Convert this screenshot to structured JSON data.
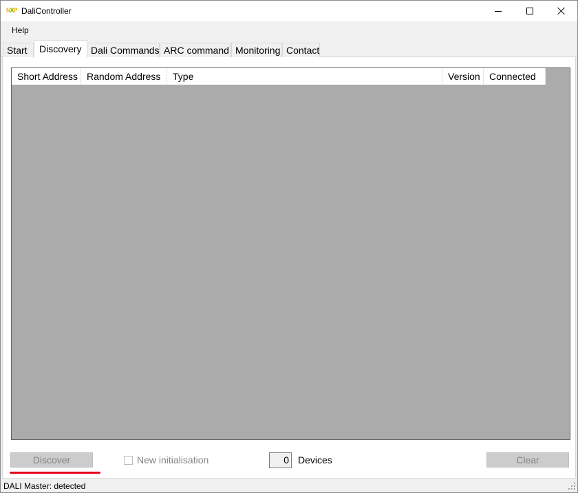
{
  "window": {
    "title": "DaliController",
    "logo": {
      "n": "N",
      "x": "X",
      "p": "P"
    }
  },
  "menu": {
    "help": "Help"
  },
  "tabs": [
    {
      "label": "Start"
    },
    {
      "label": "Discovery"
    },
    {
      "label": "Dali Commands"
    },
    {
      "label": "ARC command"
    },
    {
      "label": "Monitoring"
    },
    {
      "label": "Contact"
    }
  ],
  "active_tab": "Discovery",
  "table": {
    "columns": [
      "Short Address",
      "Random Address",
      "Type",
      "Version",
      "Connected"
    ],
    "rows": []
  },
  "controls": {
    "discover_label": "Discover",
    "new_init_label": "New initialisation",
    "new_init_checked": false,
    "device_count": "0",
    "devices_label": "Devices",
    "clear_label": "Clear"
  },
  "status": {
    "text": "DALI Master: detected"
  },
  "colors": {
    "accent_underline": "#e3001b",
    "list_background": "#ababab",
    "window_background": "#f0f0f0"
  },
  "icons": [
    "nxp-logo-icon",
    "minimize-icon",
    "maximize-icon",
    "close-icon",
    "size-grip-icon"
  ]
}
